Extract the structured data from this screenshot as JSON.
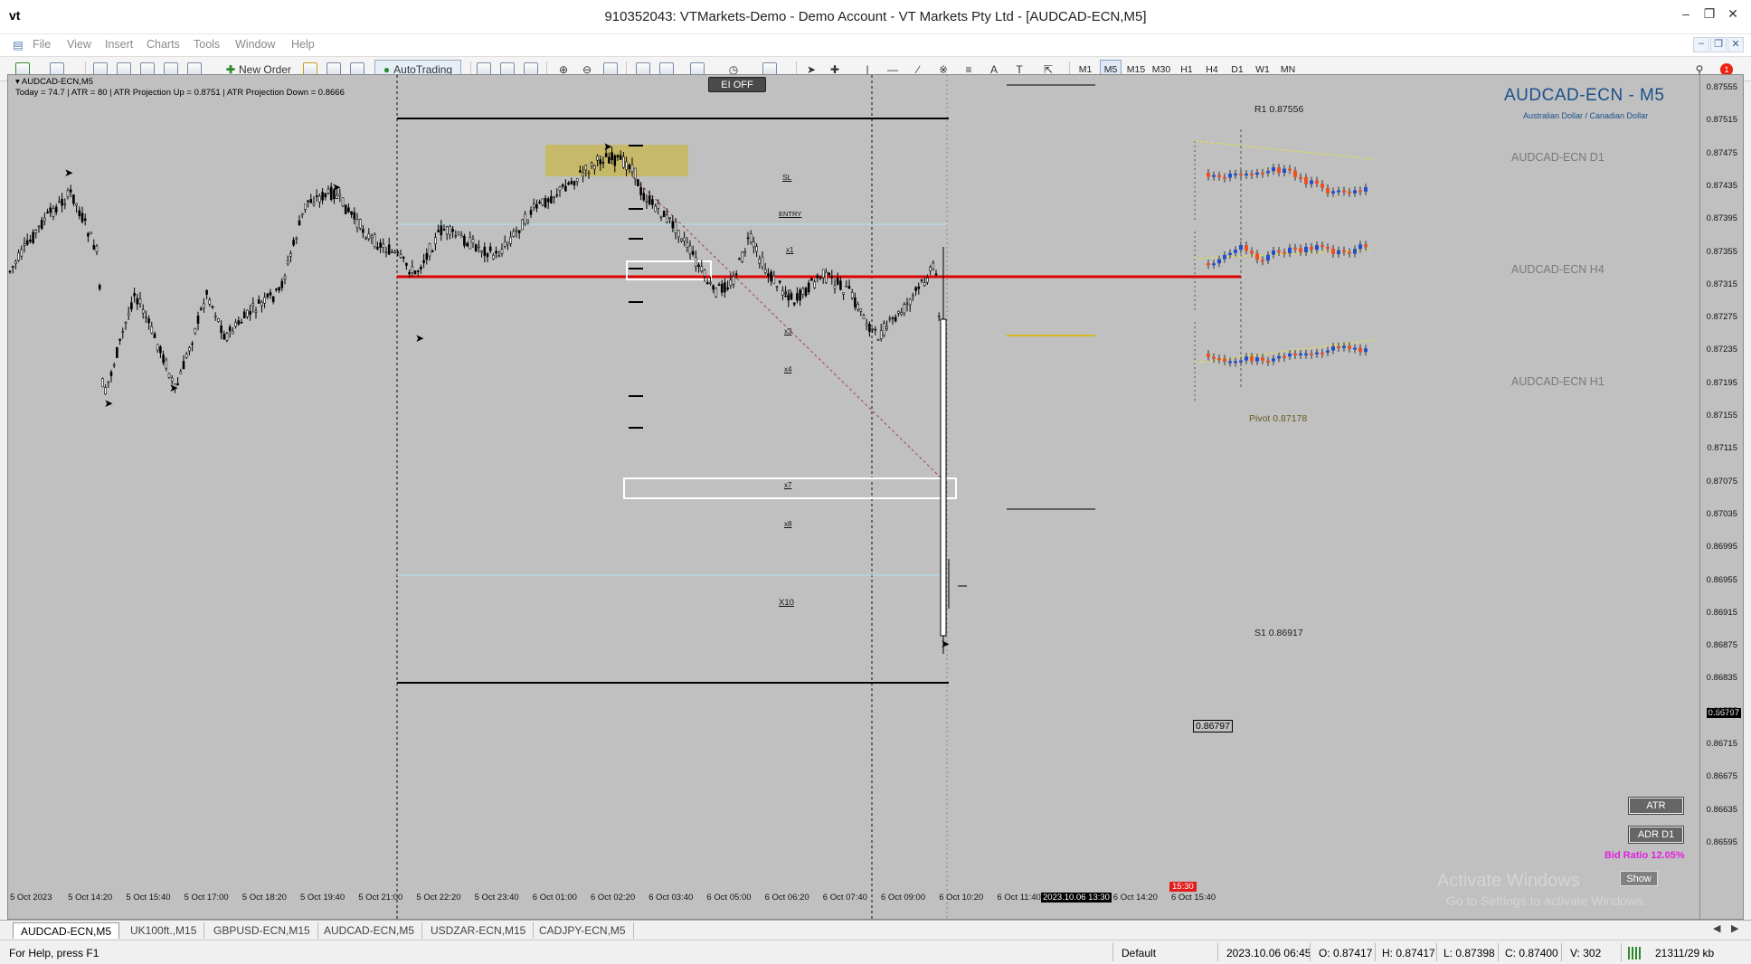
{
  "window": {
    "logo": "vt",
    "title": "910352043: VTMarkets-Demo - Demo Account - VT Markets Pty Ltd - [AUDCAD-ECN,M5]"
  },
  "menu": [
    "File",
    "View",
    "Insert",
    "Charts",
    "Tools",
    "Window",
    "Help"
  ],
  "toolbar": {
    "new_order": "New Order",
    "autotrading": "AutoTrading",
    "timeframes": [
      "M1",
      "M5",
      "M15",
      "M30",
      "H1",
      "H4",
      "D1",
      "W1",
      "MN"
    ],
    "active_timeframe": "M5"
  },
  "chart": {
    "symbol_line": "AUDCAD-ECN,M5",
    "info_line": "Today = 74.7   |   ATR = 80   |   ATR Projection Up = 0.8751   |   ATR Projection Down = 0.8666",
    "ei_button": "EI OFF",
    "big_title": "AUDCAD-ECN - M5",
    "subtitle": "Australian Dollar / Canadian Dollar",
    "mini_titles": [
      "AUDCAD-ECN D1",
      "AUDCAD-ECN H4",
      "AUDCAD-ECN H1"
    ],
    "pivots": {
      "r1": "R1 0.87556",
      "pivot": "Pivot 0.87178",
      "s1": "S1 0.86917"
    },
    "level_labels": {
      "sl": "SL",
      "entry": "ENTRY",
      "x1": "x1",
      "x2": "x2",
      "x3": "x3",
      "x4": "x4",
      "x7": "x7",
      "x8": "x8",
      "x10": "X10"
    },
    "current_price": "0.86797",
    "price_axis": [
      "0.87555",
      "0.87515",
      "0.87475",
      "0.87435",
      "0.87395",
      "0.87355",
      "0.87315",
      "0.87275",
      "0.87235",
      "0.87195",
      "0.87155",
      "0.87115",
      "0.87075",
      "0.87035",
      "0.86995",
      "0.86955",
      "0.86915",
      "0.86875",
      "0.86835",
      "0.86797",
      "0.86755",
      "0.86715",
      "0.86675",
      "0.86635",
      "0.86595"
    ],
    "time_axis": [
      "5 Oct 2023",
      "5 Oct 14:20",
      "5 Oct 15:40",
      "5 Oct 17:00",
      "5 Oct 18:20",
      "5 Oct 19:40",
      "5 Oct 21:00",
      "5 Oct 22:20",
      "5 Oct 23:40",
      "6 Oct 01:00",
      "6 Oct 02:20",
      "6 Oct 03:40",
      "6 Oct 05:00",
      "6 Oct 06:20",
      "6 Oct 07:40",
      "6 Oct 09:00",
      "6 Oct 10:20",
      "6 Oct 11:40",
      "2023.10.06 13:30",
      "6 Oct 14:20",
      "6 Oct 15:40"
    ],
    "countdown": "15:30",
    "buttons": {
      "atr": "ATR",
      "adr": "ADR D1",
      "show": "Show"
    },
    "bid_ratio": "Bid Ratio 12.05%",
    "watermark_1": "Activate Windows",
    "watermark_2": "Go to Settings to activate Windows."
  },
  "colors": {
    "chart_bg": "#c0c0c0",
    "pivot_red": "#e00000",
    "bull": "#1f4fd0",
    "bear": "#f05020",
    "zone": "#c8b860"
  },
  "tabs": [
    "AUDCAD-ECN,M5",
    "UK100ft.,M15",
    "GBPUSD-ECN,M15",
    "AUDCAD-ECN,M5",
    "USDZAR-ECN,M15",
    "CADJPY-ECN,M5"
  ],
  "status": {
    "help": "For Help, press F1",
    "profile": "Default",
    "datetime": "2023.10.06 06:45",
    "open": "O: 0.87417",
    "high": "H: 0.87417",
    "low": "L: 0.87398",
    "close": "C: 0.87400",
    "volume": "V: 302",
    "traffic": "21311/29 kb"
  }
}
